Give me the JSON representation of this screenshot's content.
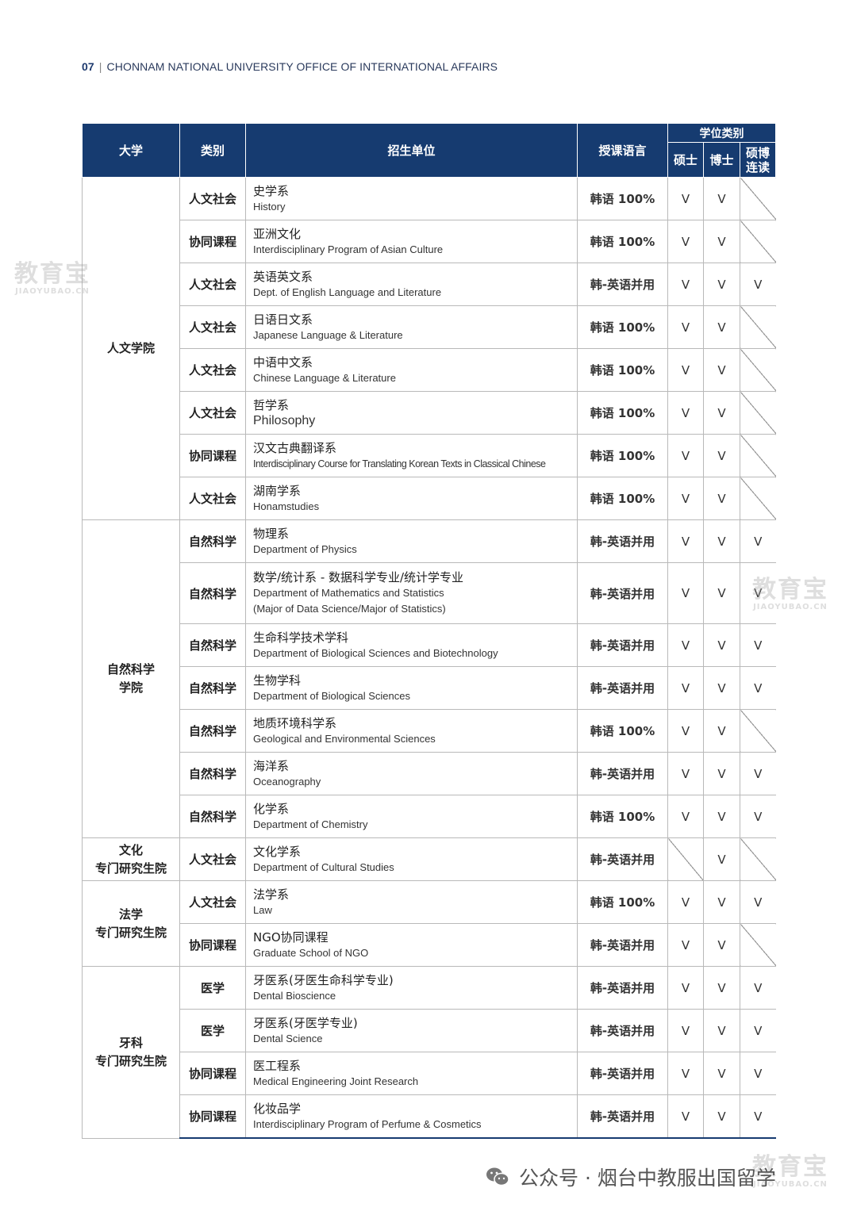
{
  "header": {
    "page_number": "07",
    "title": "CHONNAM NATIONAL UNIVERSITY OFFICE OF INTERNATIONAL AFFAIRS"
  },
  "table": {
    "headers": {
      "university": "大学",
      "category": "类别",
      "unit": "招生单位",
      "language": "授课语言",
      "degree_group": "学位类别",
      "master": "硕士",
      "doctor": "博士",
      "combined": "硕博\n连读"
    },
    "universities": [
      {
        "name": "人文学院"
      },
      {
        "name": "自然科学\n学院"
      },
      {
        "name": "文化\n专门研究生院"
      },
      {
        "name": "法学\n专门研究生院"
      },
      {
        "name": "牙科\n专门研究生院"
      }
    ],
    "rows": [
      {
        "category": "人文社会",
        "cn": "史学系",
        "en": "History",
        "lang": "韩语 100%",
        "m": "V",
        "d": "V",
        "c": ""
      },
      {
        "category": "协同课程",
        "cn": "亚洲文化",
        "en": "Interdisciplinary Program of Asian Culture",
        "lang": "韩语 100%",
        "m": "V",
        "d": "V",
        "c": ""
      },
      {
        "category": "人文社会",
        "cn": "英语英文系",
        "en": "Dept. of English Language and Literature",
        "lang": "韩-英语并用",
        "m": "V",
        "d": "V",
        "c": "V"
      },
      {
        "category": "人文社会",
        "cn": "日语日文系",
        "en": "Japanese Language & Literature",
        "lang": "韩语 100%",
        "m": "V",
        "d": "V",
        "c": ""
      },
      {
        "category": "人文社会",
        "cn": "中语中文系",
        "en": "Chinese Language & Literature",
        "lang": "韩语 100%",
        "m": "V",
        "d": "V",
        "c": ""
      },
      {
        "category": "人文社会",
        "cn": "哲学系",
        "en": "Philosophy",
        "lang": "韩语 100%",
        "m": "V",
        "d": "V",
        "c": ""
      },
      {
        "category": "协同课程",
        "cn": "汉文古典翻译系",
        "en": "Interdisciplinary Course for Translating Korean Texts in Classical Chinese",
        "lang": "韩语 100%",
        "m": "V",
        "d": "V",
        "c": ""
      },
      {
        "category": "人文社会",
        "cn": "湖南学系",
        "en": "Honamstudies",
        "lang": "韩语 100%",
        "m": "V",
        "d": "V",
        "c": ""
      },
      {
        "category": "自然科学",
        "cn": "物理系",
        "en": "Department of Physics",
        "lang": "韩-英语并用",
        "m": "V",
        "d": "V",
        "c": "V"
      },
      {
        "category": "自然科学",
        "cn": "数学/统计系 - 数据科学专业/统计学专业",
        "en": "Department of Mathematics and Statistics",
        "en2": "(Major of Data Science/Major of Statistics)",
        "lang": "韩-英语并用",
        "m": "V",
        "d": "V",
        "c": "V"
      },
      {
        "category": "自然科学",
        "cn": "生命科学技术学科",
        "en": "Department of Biological Sciences and Biotechnology",
        "lang": "韩-英语并用",
        "m": "V",
        "d": "V",
        "c": "V"
      },
      {
        "category": "自然科学",
        "cn": "生物学科",
        "en": "Department of Biological Sciences",
        "lang": "韩-英语并用",
        "m": "V",
        "d": "V",
        "c": "V"
      },
      {
        "category": "自然科学",
        "cn": "地质环境科学系",
        "en": "Geological and Environmental Sciences",
        "lang": "韩语 100%",
        "m": "V",
        "d": "V",
        "c": ""
      },
      {
        "category": "自然科学",
        "cn": "海洋系",
        "en": "Oceanography",
        "lang": "韩-英语并用",
        "m": "V",
        "d": "V",
        "c": "V"
      },
      {
        "category": "自然科学",
        "cn": "化学系",
        "en": "Department of Chemistry",
        "lang": "韩语 100%",
        "m": "V",
        "d": "V",
        "c": "V"
      },
      {
        "category": "人文社会",
        "cn": "文化学系",
        "en": "Department of Cultural Studies",
        "lang": "韩-英语并用",
        "m": "",
        "d": "V",
        "c": ""
      },
      {
        "category": "人文社会",
        "cn": "法学系",
        "en": "Law",
        "lang": "韩语 100%",
        "m": "V",
        "d": "V",
        "c": "V"
      },
      {
        "category": "协同课程",
        "cn": "NGO协同课程",
        "en": "Graduate School of NGO",
        "lang": "韩-英语并用",
        "m": "V",
        "d": "V",
        "c": ""
      },
      {
        "category": "医学",
        "cn": "牙医系(牙医生命科学专业)",
        "en": "Dental Bioscience",
        "lang": "韩-英语并用",
        "m": "V",
        "d": "V",
        "c": "V"
      },
      {
        "category": "医学",
        "cn": "牙医系(牙医学专业)",
        "en": "Dental Science",
        "lang": "韩-英语并用",
        "m": "V",
        "d": "V",
        "c": "V"
      },
      {
        "category": "协同课程",
        "cn": "医工程系",
        "en": "Medical Engineering Joint Research",
        "lang": "韩-英语并用",
        "m": "V",
        "d": "V",
        "c": "V"
      },
      {
        "category": "协同课程",
        "cn": "化妆品学",
        "en": "Interdisciplinary Program of Perfume & Cosmetics",
        "lang": "韩-英语并用",
        "m": "V",
        "d": "V",
        "c": "V"
      }
    ]
  },
  "watermark": {
    "big": "教育宝",
    "small": "JIAOYUBAO.CN"
  },
  "footer": {
    "text": "公众号 · 烟台中教服出国留学",
    "icon": "wechat-icon"
  },
  "colors": {
    "header_bg": "#163b70",
    "header_text": "#ffffff",
    "border": "#b9b9b9"
  }
}
